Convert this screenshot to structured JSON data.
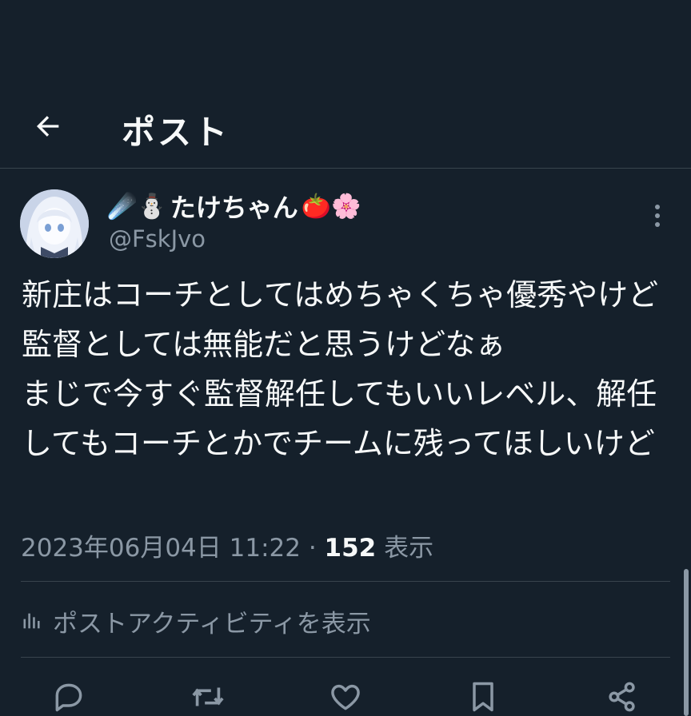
{
  "header": {
    "title": "ポスト"
  },
  "author": {
    "name_prefix_emoji": "☄️⛄",
    "name": "たけちゃん",
    "name_suffix_emoji": "🍅🌸",
    "handle": "@FskJvo"
  },
  "tweet": {
    "text": "新庄はコーチとしてはめちゃくちゃ優秀やけど監督としては無能だと思うけどなぁ\nまじで今すぐ監督解任してもいいレベル、解任してもコーチとかでチームに残ってほしいけど",
    "timestamp": "2023年06月04日 11:22",
    "separator": " · ",
    "views_count": "152",
    "views_label": " 表示"
  },
  "activity": {
    "label": "ポストアクティビティを表示"
  },
  "icons": {
    "back": "arrow-left-icon",
    "more": "more-vertical-icon",
    "activity": "bar-chart-icon",
    "reply": "reply-icon",
    "retweet": "retweet-icon",
    "like": "heart-icon",
    "bookmark": "bookmark-icon",
    "share": "share-icon"
  },
  "colors": {
    "background": "#15202b",
    "text": "#f7f9f9",
    "secondary": "#8b98a5",
    "divider": "#38444d"
  }
}
